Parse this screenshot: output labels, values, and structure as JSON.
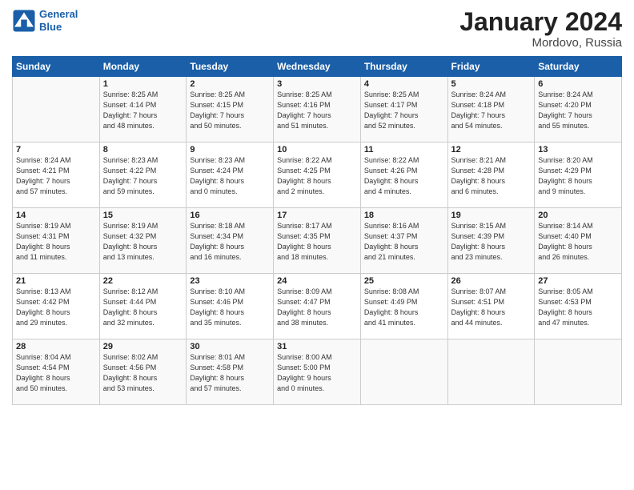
{
  "header": {
    "logo_line1": "General",
    "logo_line2": "Blue",
    "month": "January 2024",
    "location": "Mordovo, Russia"
  },
  "days_of_week": [
    "Sunday",
    "Monday",
    "Tuesday",
    "Wednesday",
    "Thursday",
    "Friday",
    "Saturday"
  ],
  "weeks": [
    [
      {
        "num": "",
        "lines": []
      },
      {
        "num": "1",
        "lines": [
          "Sunrise: 8:25 AM",
          "Sunset: 4:14 PM",
          "Daylight: 7 hours",
          "and 48 minutes."
        ]
      },
      {
        "num": "2",
        "lines": [
          "Sunrise: 8:25 AM",
          "Sunset: 4:15 PM",
          "Daylight: 7 hours",
          "and 50 minutes."
        ]
      },
      {
        "num": "3",
        "lines": [
          "Sunrise: 8:25 AM",
          "Sunset: 4:16 PM",
          "Daylight: 7 hours",
          "and 51 minutes."
        ]
      },
      {
        "num": "4",
        "lines": [
          "Sunrise: 8:25 AM",
          "Sunset: 4:17 PM",
          "Daylight: 7 hours",
          "and 52 minutes."
        ]
      },
      {
        "num": "5",
        "lines": [
          "Sunrise: 8:24 AM",
          "Sunset: 4:18 PM",
          "Daylight: 7 hours",
          "and 54 minutes."
        ]
      },
      {
        "num": "6",
        "lines": [
          "Sunrise: 8:24 AM",
          "Sunset: 4:20 PM",
          "Daylight: 7 hours",
          "and 55 minutes."
        ]
      }
    ],
    [
      {
        "num": "7",
        "lines": [
          "Sunrise: 8:24 AM",
          "Sunset: 4:21 PM",
          "Daylight: 7 hours",
          "and 57 minutes."
        ]
      },
      {
        "num": "8",
        "lines": [
          "Sunrise: 8:23 AM",
          "Sunset: 4:22 PM",
          "Daylight: 7 hours",
          "and 59 minutes."
        ]
      },
      {
        "num": "9",
        "lines": [
          "Sunrise: 8:23 AM",
          "Sunset: 4:24 PM",
          "Daylight: 8 hours",
          "and 0 minutes."
        ]
      },
      {
        "num": "10",
        "lines": [
          "Sunrise: 8:22 AM",
          "Sunset: 4:25 PM",
          "Daylight: 8 hours",
          "and 2 minutes."
        ]
      },
      {
        "num": "11",
        "lines": [
          "Sunrise: 8:22 AM",
          "Sunset: 4:26 PM",
          "Daylight: 8 hours",
          "and 4 minutes."
        ]
      },
      {
        "num": "12",
        "lines": [
          "Sunrise: 8:21 AM",
          "Sunset: 4:28 PM",
          "Daylight: 8 hours",
          "and 6 minutes."
        ]
      },
      {
        "num": "13",
        "lines": [
          "Sunrise: 8:20 AM",
          "Sunset: 4:29 PM",
          "Daylight: 8 hours",
          "and 9 minutes."
        ]
      }
    ],
    [
      {
        "num": "14",
        "lines": [
          "Sunrise: 8:19 AM",
          "Sunset: 4:31 PM",
          "Daylight: 8 hours",
          "and 11 minutes."
        ]
      },
      {
        "num": "15",
        "lines": [
          "Sunrise: 8:19 AM",
          "Sunset: 4:32 PM",
          "Daylight: 8 hours",
          "and 13 minutes."
        ]
      },
      {
        "num": "16",
        "lines": [
          "Sunrise: 8:18 AM",
          "Sunset: 4:34 PM",
          "Daylight: 8 hours",
          "and 16 minutes."
        ]
      },
      {
        "num": "17",
        "lines": [
          "Sunrise: 8:17 AM",
          "Sunset: 4:35 PM",
          "Daylight: 8 hours",
          "and 18 minutes."
        ]
      },
      {
        "num": "18",
        "lines": [
          "Sunrise: 8:16 AM",
          "Sunset: 4:37 PM",
          "Daylight: 8 hours",
          "and 21 minutes."
        ]
      },
      {
        "num": "19",
        "lines": [
          "Sunrise: 8:15 AM",
          "Sunset: 4:39 PM",
          "Daylight: 8 hours",
          "and 23 minutes."
        ]
      },
      {
        "num": "20",
        "lines": [
          "Sunrise: 8:14 AM",
          "Sunset: 4:40 PM",
          "Daylight: 8 hours",
          "and 26 minutes."
        ]
      }
    ],
    [
      {
        "num": "21",
        "lines": [
          "Sunrise: 8:13 AM",
          "Sunset: 4:42 PM",
          "Daylight: 8 hours",
          "and 29 minutes."
        ]
      },
      {
        "num": "22",
        "lines": [
          "Sunrise: 8:12 AM",
          "Sunset: 4:44 PM",
          "Daylight: 8 hours",
          "and 32 minutes."
        ]
      },
      {
        "num": "23",
        "lines": [
          "Sunrise: 8:10 AM",
          "Sunset: 4:46 PM",
          "Daylight: 8 hours",
          "and 35 minutes."
        ]
      },
      {
        "num": "24",
        "lines": [
          "Sunrise: 8:09 AM",
          "Sunset: 4:47 PM",
          "Daylight: 8 hours",
          "and 38 minutes."
        ]
      },
      {
        "num": "25",
        "lines": [
          "Sunrise: 8:08 AM",
          "Sunset: 4:49 PM",
          "Daylight: 8 hours",
          "and 41 minutes."
        ]
      },
      {
        "num": "26",
        "lines": [
          "Sunrise: 8:07 AM",
          "Sunset: 4:51 PM",
          "Daylight: 8 hours",
          "and 44 minutes."
        ]
      },
      {
        "num": "27",
        "lines": [
          "Sunrise: 8:05 AM",
          "Sunset: 4:53 PM",
          "Daylight: 8 hours",
          "and 47 minutes."
        ]
      }
    ],
    [
      {
        "num": "28",
        "lines": [
          "Sunrise: 8:04 AM",
          "Sunset: 4:54 PM",
          "Daylight: 8 hours",
          "and 50 minutes."
        ]
      },
      {
        "num": "29",
        "lines": [
          "Sunrise: 8:02 AM",
          "Sunset: 4:56 PM",
          "Daylight: 8 hours",
          "and 53 minutes."
        ]
      },
      {
        "num": "30",
        "lines": [
          "Sunrise: 8:01 AM",
          "Sunset: 4:58 PM",
          "Daylight: 8 hours",
          "and 57 minutes."
        ]
      },
      {
        "num": "31",
        "lines": [
          "Sunrise: 8:00 AM",
          "Sunset: 5:00 PM",
          "Daylight: 9 hours",
          "and 0 minutes."
        ]
      },
      {
        "num": "",
        "lines": []
      },
      {
        "num": "",
        "lines": []
      },
      {
        "num": "",
        "lines": []
      }
    ]
  ]
}
